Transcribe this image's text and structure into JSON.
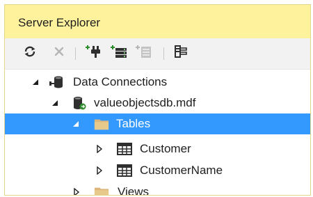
{
  "panel": {
    "title": "Server Explorer"
  },
  "toolbar": {
    "refresh_icon": "refresh-icon",
    "stop_icon": "stop-icon",
    "connect_to_database_icon": "connect-to-database-icon",
    "connect_to_server_icon": "connect-to-server-icon",
    "connect_to_sharepoint_icon": "connect-to-sharepoint-icon",
    "properties_icon": "properties-icon"
  },
  "tree": {
    "data_connections": {
      "label": "Data Connections",
      "expanded": true
    },
    "database": {
      "label": "valueobjectsdb.mdf",
      "expanded": true
    },
    "tables": {
      "label": "Tables",
      "expanded": true,
      "selected": true
    },
    "table_customer": {
      "label": "Customer",
      "expanded": false
    },
    "table_customername": {
      "label": "CustomerName",
      "expanded": false
    },
    "views": {
      "label": "Views",
      "expanded": false
    }
  },
  "colors": {
    "title_bar_background": "#fff29d",
    "selection_background": "#3399ff",
    "folder_icon": "#dcb67a"
  }
}
